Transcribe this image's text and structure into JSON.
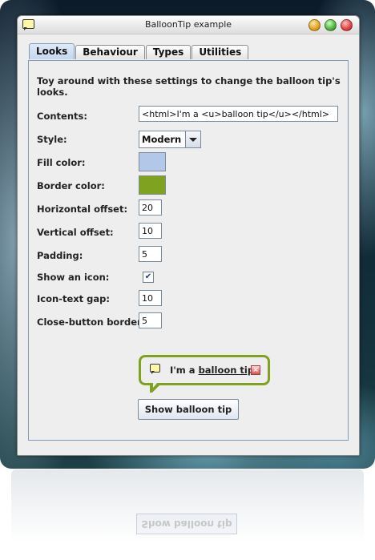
{
  "window": {
    "title": "BalloonTip example"
  },
  "tabs": [
    {
      "label": "Looks",
      "active": true
    },
    {
      "label": "Behaviour",
      "active": false
    },
    {
      "label": "Types",
      "active": false
    },
    {
      "label": "Utilities",
      "active": false
    }
  ],
  "looks": {
    "intro": "Toy around with these settings to change the balloon tip's looks.",
    "contents_label": "Contents:",
    "contents_value": "<html>I'm a <u>balloon tip</u></html>",
    "style_label": "Style:",
    "style_value": "Modern",
    "fill_color_label": "Fill color:",
    "fill_color": "#b3c7e8",
    "border_color_label": "Border color:",
    "border_color": "#7fa31f",
    "horizontal_offset_label": "Horizontal offset:",
    "horizontal_offset": "20",
    "vertical_offset_label": "Vertical offset:",
    "vertical_offset": "10",
    "padding_label": "Padding:",
    "padding": "5",
    "show_icon_label": "Show an icon:",
    "show_icon_checked": true,
    "icon_text_gap_label": "Icon-text gap:",
    "icon_text_gap": "10",
    "close_button_border_label": "Close-button border:",
    "close_button_border": "5"
  },
  "balloon": {
    "text_prefix": "I'm a ",
    "text_underlined": "balloon tip"
  },
  "show_button_label": "Show balloon tip"
}
